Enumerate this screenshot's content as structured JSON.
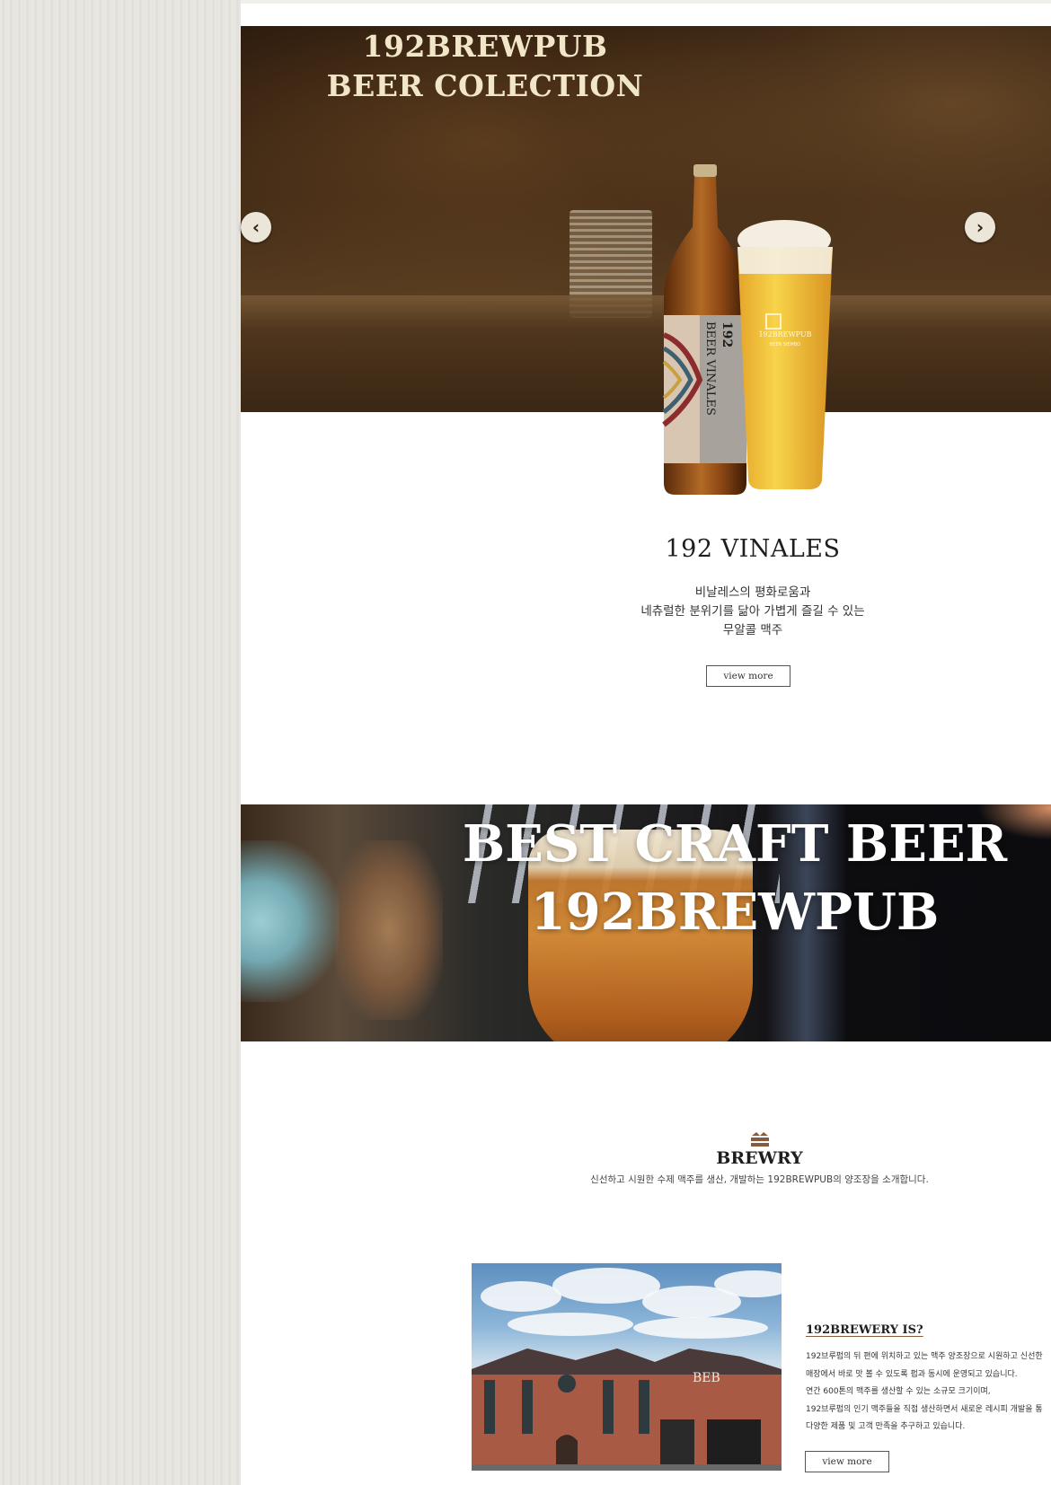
{
  "hero": {
    "title_line1": "192BREWPUB",
    "title_line2": "BEER COLECTION",
    "prev_arrow": "‹",
    "next_arrow": "›"
  },
  "product": {
    "bottle_brand": "192",
    "bottle_label": "BEER VINALES",
    "glass_brand": "192BREWPUB",
    "glass_sub": "BEER SIEMBO",
    "name": "192 VINALES",
    "description": [
      "비날레스의 평화로움과",
      "네츄럴한 분위기를 닮아 가볍게 즐길 수 있는",
      "무알콜 맥주"
    ],
    "button_label": "view more"
  },
  "banner": {
    "line1": "BEST CRAFT BEER",
    "line2": "192BREWPUB"
  },
  "brewery": {
    "icon": "brewery-logo-icon",
    "title": "BREWRY",
    "subtitle": "신선하고 시원한 수제 맥주를 생산, 개발하는 192BREWPUB의 양조장을 소개합니다.",
    "building_sign": "BEB",
    "info_title": "192BREWERY IS?",
    "info_lines": [
      "192브루펍의 뒤 편에 위치하고 있는 맥주 양조장으로 시원하고 신선한",
      "매장에서 바로 맛 볼 수 있도록 펍과 동시에 운영되고 있습니다.",
      "연간 600톤의 맥주를 생산할 수 있는 소규모 크기이며,",
      "192브루펍의 인기 맥주들을 직접 생산하면서 새로운 레시피 개발을 통",
      "다양한 제품 및 고객 만족을 추구하고 있습니다."
    ],
    "button_label": "view more"
  },
  "colors": {
    "accent_brown": "#8a5a3c",
    "hero_title": "#f2e6c8",
    "page_bg": "#e8e6e1"
  }
}
